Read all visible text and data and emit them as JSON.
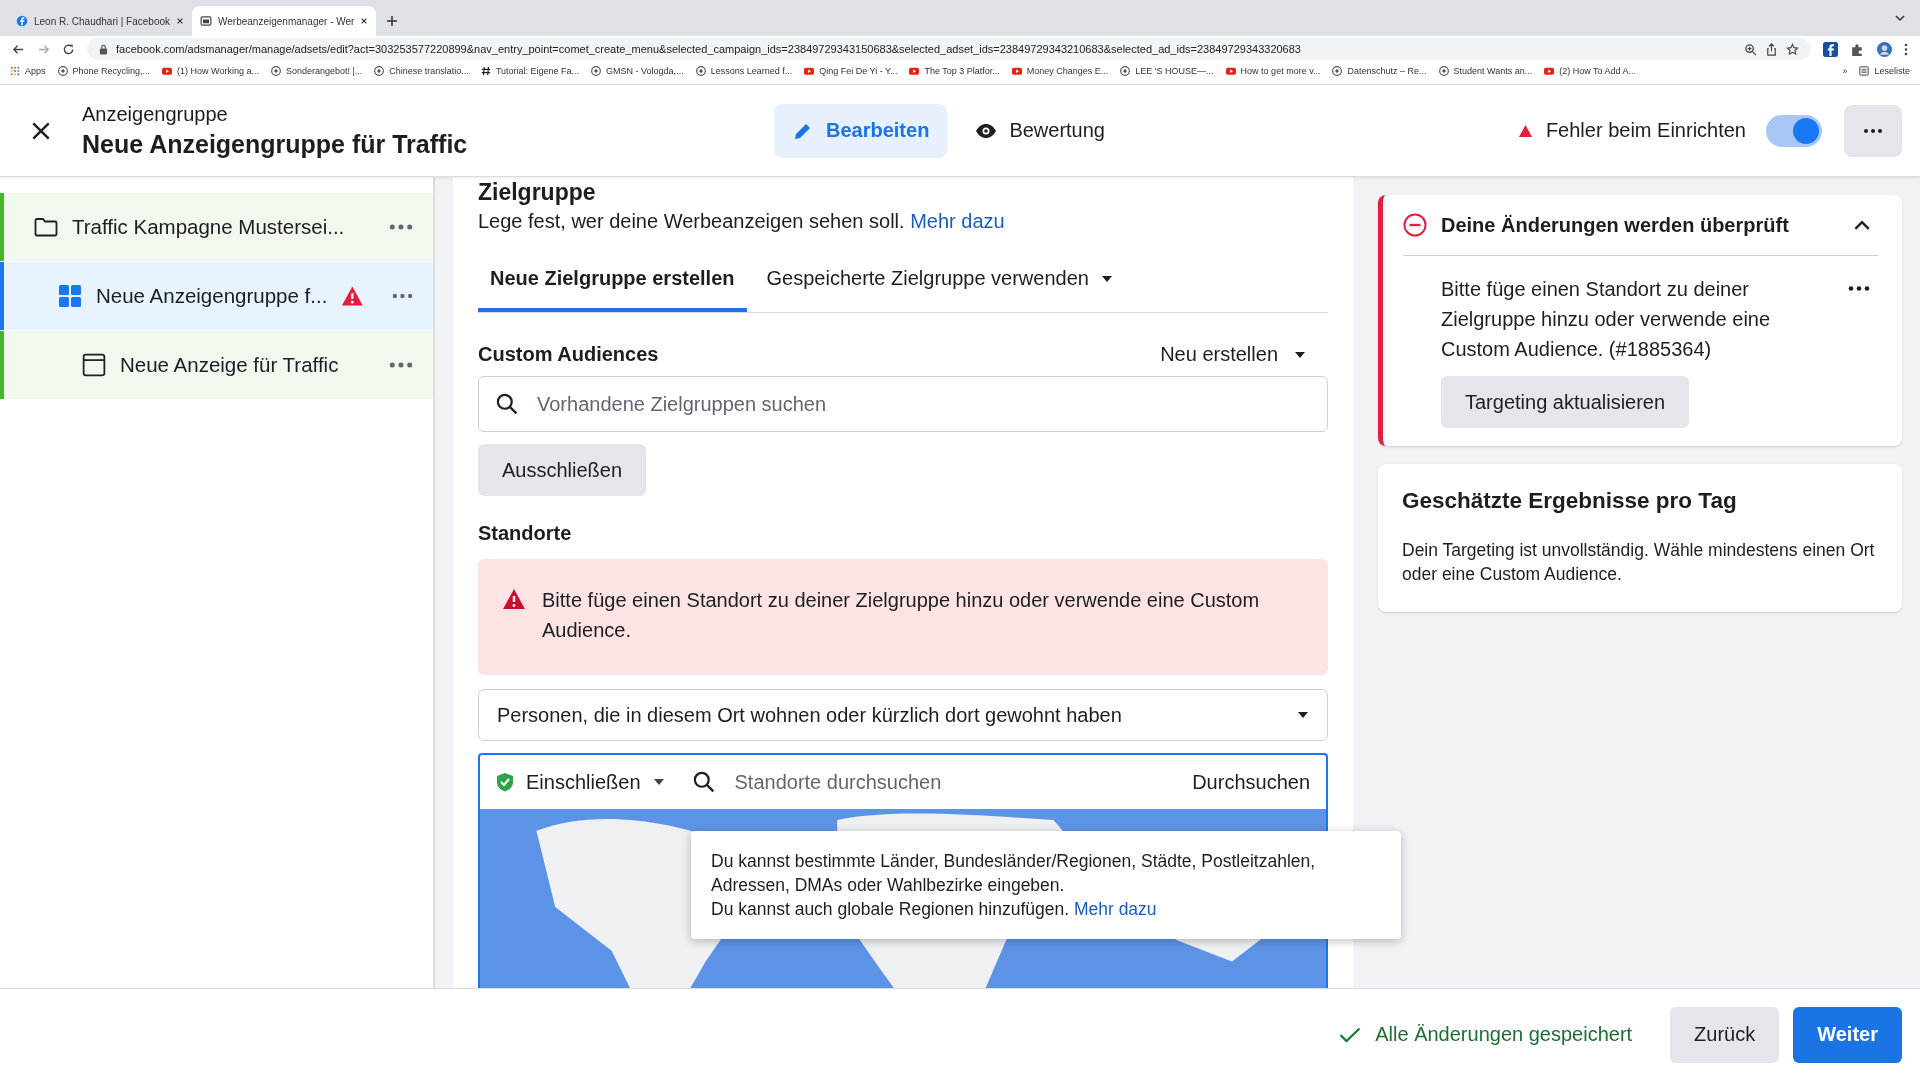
{
  "browser": {
    "tabs": [
      {
        "title": "Leon R. Chaudhari | Facebook",
        "selected": false
      },
      {
        "title": "Werbeanzeigenmanager - Wer",
        "selected": true
      }
    ],
    "url": "facebook.com/adsmanager/manage/adsets/edit?act=303253577220899&nav_entry_point=comet_create_menu&selected_campaign_ids=23849729343150683&selected_adset_ids=23849729343210683&selected_ad_ids=23849729343320683",
    "apps": "Apps",
    "bookmarks": [
      {
        "label": "Phone Recycling,...",
        "kind": "site"
      },
      {
        "label": "(1) How Working a...",
        "kind": "video"
      },
      {
        "label": "Sonderangebot! |...",
        "kind": "site"
      },
      {
        "label": "Chinese translatio...",
        "kind": "site"
      },
      {
        "label": "Tutorial: Eigene Fa...",
        "kind": "hash"
      },
      {
        "label": "GMSN - Vologda,...",
        "kind": "site"
      },
      {
        "label": "Lessons Learned f...",
        "kind": "site"
      },
      {
        "label": "Qing Fei De Yi - Y...",
        "kind": "video"
      },
      {
        "label": "The Top 3 Platfor...",
        "kind": "video"
      },
      {
        "label": "Money Changes E...",
        "kind": "video"
      },
      {
        "label": "LEE 'S HOUSE—...",
        "kind": "site"
      },
      {
        "label": "How to get more v...",
        "kind": "video"
      },
      {
        "label": "Datenschutz – Re...",
        "kind": "site"
      },
      {
        "label": "Student Wants an...",
        "kind": "site"
      },
      {
        "label": "(2) How To Add A...",
        "kind": "video"
      }
    ],
    "more": "»",
    "reading_list": "Leseliste"
  },
  "header": {
    "label": "Anzeigengruppe",
    "title": "Neue Anzeigengruppe für Traffic",
    "modes": [
      {
        "label": "Bearbeiten",
        "kind": "edit",
        "selected": true
      },
      {
        "label": "Bewertung",
        "kind": "review",
        "selected": false
      }
    ],
    "error": "Fehler beim Einrichten",
    "toggle_on": true
  },
  "sidebar": {
    "items": [
      {
        "kind": "campaign",
        "label": "Traffic Kampagne Mustersei...",
        "selected": false,
        "warning": false,
        "children": [
          {
            "kind": "adset",
            "label": "Neue Anzeigengruppe f...",
            "selected": true,
            "warning": true,
            "children": [
              {
                "kind": "ad",
                "label": "Neue Anzeige für Traffic",
                "selected": false,
                "warning": false
              }
            ]
          }
        ]
      }
    ]
  },
  "audience": {
    "heading": "Zielgruppe",
    "description": "Lege fest, wer deine Werbeanzeigen sehen soll.",
    "link": "Mehr dazu",
    "tabs": [
      {
        "label": "Neue Zielgruppe erstellen",
        "selected": true,
        "dropdown": false
      },
      {
        "label": "Gespeicherte Zielgruppe verwenden",
        "selected": false,
        "dropdown": true
      }
    ],
    "custom_audiences": {
      "heading": "Custom Audiences",
      "create": "Neu erstellen",
      "search_placeholder": "Vorhandene Zielgruppen suchen",
      "exclude": "Ausschließen"
    },
    "locations": {
      "heading": "Standorte",
      "error": "Bitte füge einen Standort zu deiner Zielgruppe hinzu oder verwende eine Custom Audience.",
      "people": "Personen, die in diesem Ort wohnen oder kürzlich dort gewohnt haben",
      "include": "Einschließen",
      "search_placeholder": "Standorte durchsuchen",
      "browse": "Durchsuchen",
      "tooltip": {
        "lines": [
          "Du kannst bestimmte Länder, Bundesländer/Regionen, Städte, Postleitzahlen, Adressen, DMAs oder Wahlbezirke eingeben.",
          "Du kannst auch globale Regionen hinzufügen."
        ],
        "link": "Mehr dazu"
      }
    }
  },
  "review": {
    "title": "Deine Änderungen werden überprüft",
    "expanded": true,
    "message": "Bitte füge einen Standort zu deiner Zielgruppe hinzu oder verwende eine Custom Audience. (#1885364)",
    "button": "Targeting aktualisieren"
  },
  "estimate": {
    "title": "Geschätzte Ergebnisse pro Tag",
    "text": "Dein Targeting ist unvollständig. Wähle mindestens einen Ort oder eine Custom Audience."
  },
  "footer": {
    "saved": "Alle Änderungen gespeichert",
    "back": "Zurück",
    "next": "Weiter"
  }
}
